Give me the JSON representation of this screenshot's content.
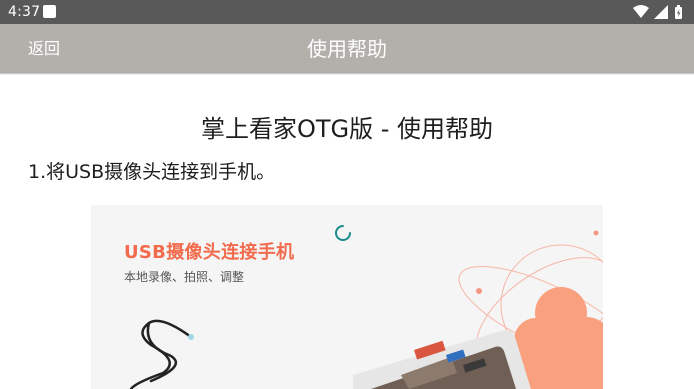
{
  "status_bar": {
    "time": "4:37"
  },
  "app_bar": {
    "back_label": "返回",
    "title": "使用帮助"
  },
  "content": {
    "heading": "掌上看家OTG版 - 使用帮助",
    "step_1": "1.将USB摄像头连接到手机。",
    "banner": {
      "title": "USB摄像头连接手机",
      "subtitle": "本地录像、拍照、调整"
    }
  },
  "colors": {
    "status_bar": "#595959",
    "app_bar": "#b3b0ab",
    "banner_accent": "#f26b4d",
    "spinner": "#1a8a8a"
  }
}
